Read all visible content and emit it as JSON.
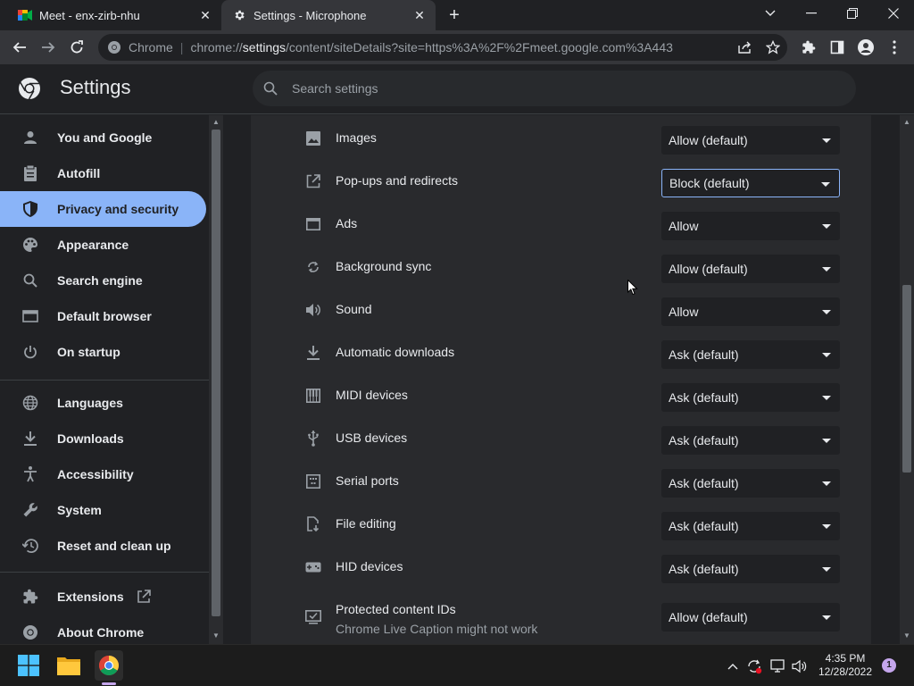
{
  "browser": {
    "tabs": [
      {
        "label": "Meet - enx-zirb-nhu",
        "icon": "google-meet-icon"
      },
      {
        "label": "Settings - Microphone",
        "icon": "gear-icon"
      }
    ],
    "omnibox": {
      "site_label": "Chrome",
      "url_prefix": "chrome://",
      "url_host": "settings",
      "url_rest": "/content/siteDetails?site=https%3A%2F%2Fmeet.google.com%3A443"
    }
  },
  "header": {
    "title": "Settings",
    "search_placeholder": "Search settings"
  },
  "sidebar": {
    "items": [
      {
        "label": "You and Google",
        "icon": "person-icon"
      },
      {
        "label": "Autofill",
        "icon": "clipboard-icon"
      },
      {
        "label": "Privacy and security",
        "icon": "shield-icon",
        "active": true
      },
      {
        "label": "Appearance",
        "icon": "palette-icon"
      },
      {
        "label": "Search engine",
        "icon": "search-icon"
      },
      {
        "label": "Default browser",
        "icon": "browser-icon"
      },
      {
        "label": "On startup",
        "icon": "power-icon"
      },
      {
        "label": "Languages",
        "icon": "globe-icon"
      },
      {
        "label": "Downloads",
        "icon": "download-icon"
      },
      {
        "label": "Accessibility",
        "icon": "accessibility-icon"
      },
      {
        "label": "System",
        "icon": "wrench-icon"
      },
      {
        "label": "Reset and clean up",
        "icon": "restore-icon"
      },
      {
        "label": "Extensions",
        "icon": "puzzle-icon"
      },
      {
        "label": "About Chrome",
        "icon": "chrome-icon"
      }
    ]
  },
  "permissions": [
    {
      "label": "Images",
      "value": "Allow (default)",
      "icon": "image-icon"
    },
    {
      "label": "Pop-ups and redirects",
      "value": "Block (default)",
      "icon": "open-external-icon",
      "focused": true
    },
    {
      "label": "Ads",
      "value": "Allow",
      "icon": "window-icon"
    },
    {
      "label": "Background sync",
      "value": "Allow (default)",
      "icon": "sync-icon"
    },
    {
      "label": "Sound",
      "value": "Allow",
      "icon": "volume-icon"
    },
    {
      "label": "Automatic downloads",
      "value": "Ask (default)",
      "icon": "download-icon"
    },
    {
      "label": "MIDI devices",
      "value": "Ask (default)",
      "icon": "piano-icon"
    },
    {
      "label": "USB devices",
      "value": "Ask (default)",
      "icon": "usb-icon"
    },
    {
      "label": "Serial ports",
      "value": "Ask (default)",
      "icon": "serial-port-icon"
    },
    {
      "label": "File editing",
      "value": "Ask (default)",
      "icon": "file-edit-icon"
    },
    {
      "label": "HID devices",
      "value": "Ask (default)",
      "icon": "gamepad-icon"
    },
    {
      "label": "Protected content IDs",
      "sublabel": "Chrome Live Caption might not work",
      "value": "Allow (default)",
      "icon": "checkbox-screen-icon"
    }
  ],
  "taskbar": {
    "time": "4:35 PM",
    "date": "12/28/2022",
    "notification_count": "1"
  },
  "colors": {
    "accent": "#8ab4f8",
    "background": "#202124",
    "card": "#292a2d"
  }
}
